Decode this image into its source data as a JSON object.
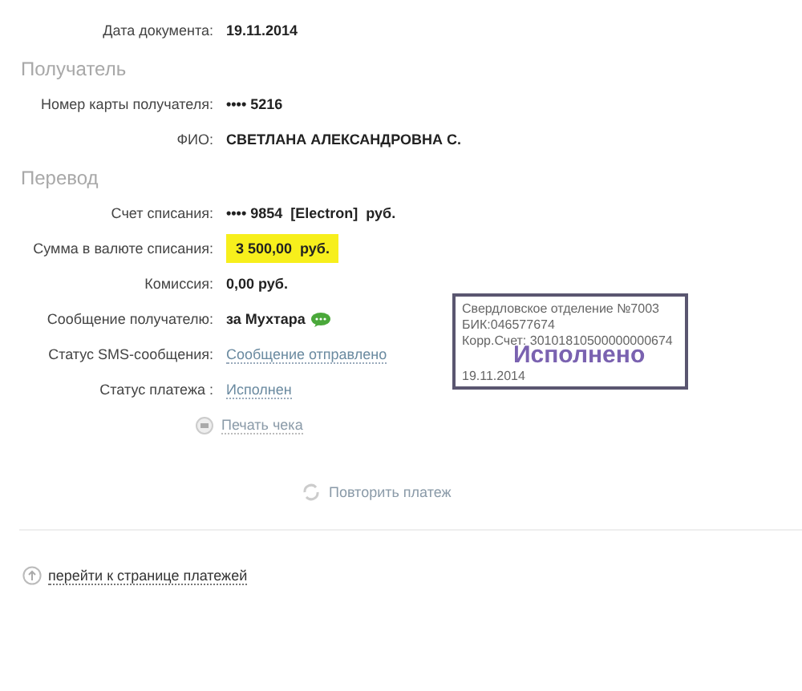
{
  "sections": [
    {
      "rows": [
        {
          "label": "Дата документа:",
          "value": "19.11.2014",
          "kind": "bold"
        }
      ]
    },
    {
      "title": "Получатель",
      "rows": [
        {
          "label": "Номер карты получателя:",
          "value": "•••• 5216",
          "kind": "bold"
        },
        {
          "label": "ФИО:",
          "value": "СВЕТЛАНА АЛЕКСАНДРОВНА С.",
          "kind": "bold"
        }
      ]
    },
    {
      "title": "Перевод",
      "rows": [
        {
          "label": "Счет списания:",
          "value": "•••• 9854  [Electron]  руб.",
          "kind": "bold"
        },
        {
          "label": "Сумма в валюте списания:",
          "value": "3 500,00  руб.",
          "kind": "amount"
        },
        {
          "label": "Комиссия:",
          "value": "0,00 руб.",
          "kind": "bold"
        },
        {
          "label": "Сообщение получателю:",
          "value": "за Мухтара",
          "kind": "message"
        },
        {
          "label": "Статус SMS-сообщения:",
          "value": "Сообщение отправлено",
          "kind": "link"
        },
        {
          "label": "Статус платежа :",
          "value": "Исполнен",
          "kind": "link"
        }
      ]
    }
  ],
  "print_link": "Печать чека",
  "stamp": {
    "lines": [
      "Свердловское отделение №7003",
      "БИК:046577674",
      "Корр.Счет: 30101810500000000674"
    ],
    "status": "Исполнено",
    "date": "19.11.2014"
  },
  "repeat_button": "Повторить платеж",
  "back_link": "перейти к странице платежей"
}
